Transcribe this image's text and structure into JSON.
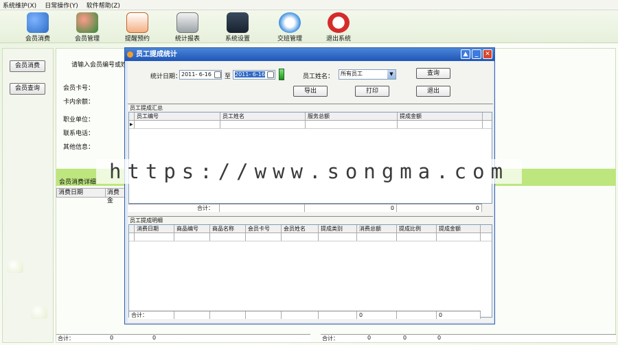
{
  "menu": [
    "系统维护(X)",
    "日常操作(Y)",
    "软件帮助(Z)"
  ],
  "toolbar": [
    {
      "label": "会员消费",
      "icon": "member-consume-icon",
      "color": "#2b6cc4"
    },
    {
      "label": "会员管理",
      "icon": "member-manage-icon",
      "color": "#c0392b"
    },
    {
      "label": "提醒预约",
      "icon": "calendar-icon",
      "color": "#d35400"
    },
    {
      "label": "统计报表",
      "icon": "register-icon",
      "color": "#7f8c8d"
    },
    {
      "label": "系统设置",
      "icon": "settings-icon",
      "color": "#34495e"
    },
    {
      "label": "交班管理",
      "icon": "recycle-icon",
      "color": "#2980b9"
    },
    {
      "label": "退出系统",
      "icon": "exit-icon",
      "color": "#c0392b"
    }
  ],
  "left": {
    "btn_consume": "会员消费",
    "btn_query": "会员查询"
  },
  "main": {
    "prompt": "请输入会员编号或姓名",
    "card_no": "会员卡号：",
    "balance": "卡内余额：",
    "unit": "职业单位：",
    "phone": "联系电话：",
    "other": "其他信息：",
    "detail_title": "会员消费详细",
    "col_date": "消费日期",
    "col_consume": "消费金"
  },
  "bottom": {
    "left": [
      "合计：",
      "0",
      "0"
    ],
    "right": [
      "合计：",
      "0",
      "0",
      "0"
    ]
  },
  "dialog": {
    "title": "员工提成统计",
    "date_label": "统计日期：",
    "date_from": "2011- 6-16",
    "to": "至",
    "date_to": "2011- 6-16",
    "emp_label": "员工姓名：",
    "emp_value": "所有员工",
    "btn_query": "查询",
    "btn_export": "导出",
    "btn_print": "打印",
    "btn_exit": "退出",
    "summary_title": "员工提成汇总",
    "summary_cols": [
      "员工编号",
      "员工姓名",
      "服务总额",
      "提成金额"
    ],
    "summary_total": [
      "合计：",
      "",
      "0",
      "0"
    ],
    "detail_title": "员工提成明细",
    "detail_cols": [
      "消费日期",
      "商品编号",
      "商品名称",
      "会员卡号",
      "会员姓名",
      "提成类别",
      "消费总额",
      "提成比例",
      "提成金额"
    ],
    "detail_total": [
      "合计：",
      "",
      "",
      "",
      "",
      "",
      "0",
      "",
      "0"
    ]
  },
  "watermark": "https://www.songma.com"
}
